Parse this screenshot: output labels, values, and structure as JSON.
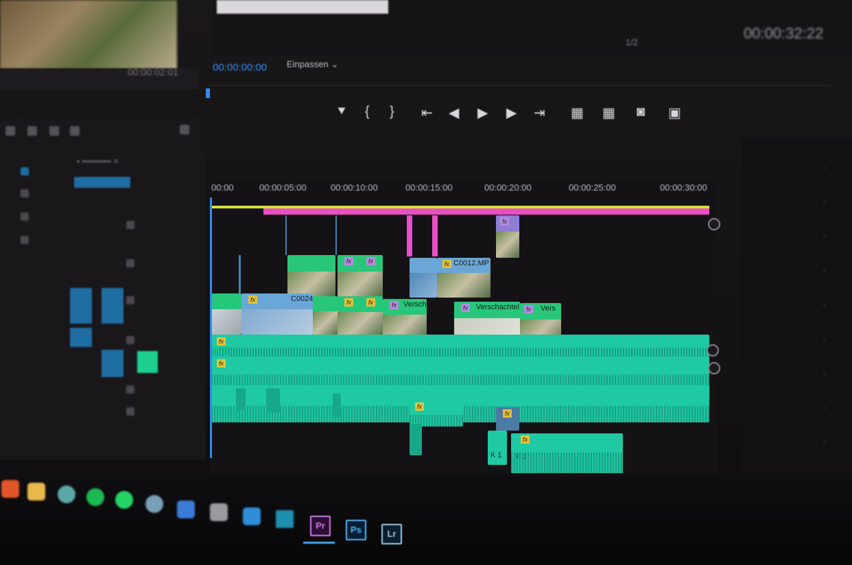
{
  "source_monitor": {
    "timecode": "00:00:02:01"
  },
  "program_monitor": {
    "timecode": "00:00:00:00",
    "fit_select": "Einpassen",
    "ratio": "1/2",
    "duration": "00:00:32:22"
  },
  "timeline": {
    "ruler_labels": [
      "00:00",
      "00:00:05:00",
      "00:00:10:00",
      "00:00:15:00",
      "00:00:20:00",
      "00:00:25:00",
      "00:00:30:00"
    ],
    "clip_labels": {
      "c0012": "C0012.MP",
      "c0024": "C0024",
      "versch1": "Versche",
      "versch2": "Verschachtel",
      "versch3": "Vers"
    },
    "fx_label": "fx",
    "k_label": "K 1"
  },
  "taskbar": {
    "apps": [
      {
        "name": "firefox",
        "color": "#e0562a"
      },
      {
        "name": "files",
        "color": "#e7b84c"
      },
      {
        "name": "app3",
        "color": "#5aa6a8"
      },
      {
        "name": "spotify",
        "color": "#1db954"
      },
      {
        "name": "whatsapp",
        "color": "#25d366"
      },
      {
        "name": "app6",
        "color": "#7aa0b8"
      },
      {
        "name": "app7",
        "color": "#3b7bd8"
      },
      {
        "name": "app8",
        "color": "#9a9aa0"
      },
      {
        "name": "app9",
        "color": "#2e8fd8"
      },
      {
        "name": "app10",
        "color": "#1c8fb0"
      }
    ],
    "premiere": "Pr",
    "photoshop": "Ps",
    "lightroom": "Lr"
  }
}
